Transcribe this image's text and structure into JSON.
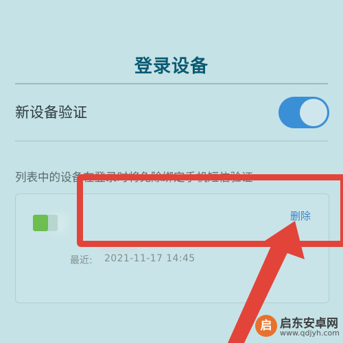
{
  "header": {
    "title": "登录设备"
  },
  "settings": {
    "new_device_verify_label": "新设备验证",
    "new_device_verify_enabled": true
  },
  "description": "列表中的设备在登录时将免除绑定手机短信验证",
  "device_card": {
    "recent_label": "最近:",
    "recent_time": "2021-11-17 14:45",
    "delete_label": "删除"
  },
  "watermark": {
    "icon_glyph": "启",
    "title": "启东安卓网",
    "url": "www.qdjyh.com"
  },
  "colors": {
    "accent": "#3b8fd6",
    "title": "#0a5a72",
    "annotation": "#e2443a",
    "background": "#c5e2e6"
  }
}
